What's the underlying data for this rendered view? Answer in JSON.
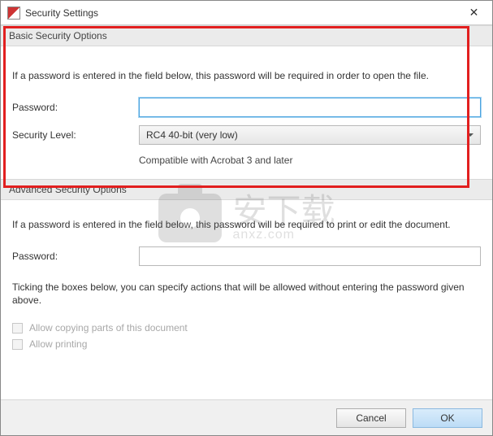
{
  "window": {
    "title": "Security Settings"
  },
  "basic": {
    "header": "Basic Security Options",
    "intro": "If a password is entered in the field below, this password will be required in order to open the file.",
    "password_label": "Password:",
    "password_value": "",
    "security_level_label": "Security Level:",
    "security_level_value": "RC4 40-bit (very low)",
    "compat_hint": "Compatible with Acrobat 3 and later"
  },
  "advanced": {
    "header": "Advanced Security Options",
    "intro": "If a password is entered in the field below, this password will be required to print or edit the document.",
    "password_label": "Password:",
    "password_value": "",
    "tick_intro": "Ticking the boxes below, you can specify actions that will be allowed without entering the password given above.",
    "allow_copy_label": "Allow copying parts of this document",
    "allow_print_label": "Allow printing"
  },
  "buttons": {
    "cancel": "Cancel",
    "ok": "OK"
  },
  "watermark": {
    "text_main": "安下载",
    "text_sub": "anxz.com"
  }
}
